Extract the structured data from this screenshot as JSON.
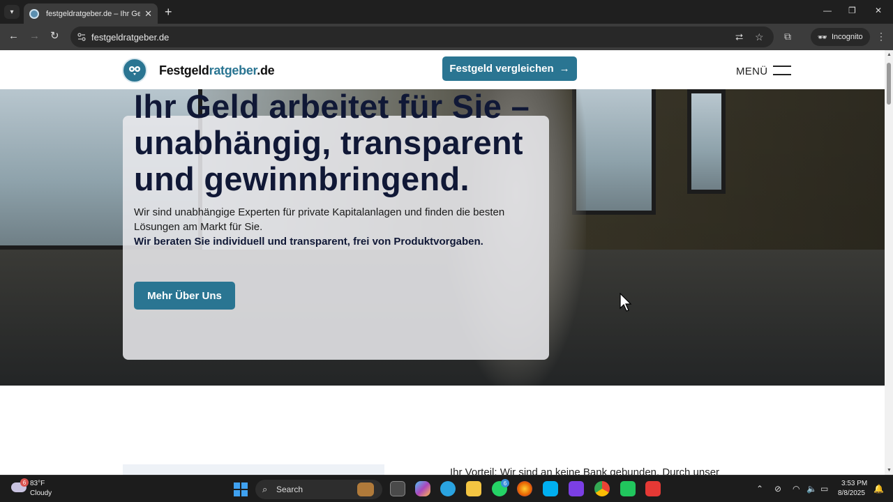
{
  "browser": {
    "tab_title": "festgeldratgeber.de – Ihr Geld a",
    "url": "festgeldratgeber.de",
    "incognito_label": "Incognito"
  },
  "site": {
    "logo_main": "Festgeld",
    "logo_accent": "ratgeber",
    "logo_tld": ".de",
    "cta_label": "Festgeld vergleichen",
    "menu_label": "MENÜ",
    "brand_color": "#2a7592"
  },
  "hero": {
    "title": "Ihr Geld arbeitet für Sie – unabhängig, transparent und gewinnbringend.",
    "subtitle": "Wir sind unabhängige Experten für private Kapitalanlagen und finden die besten Lösungen am Markt für Sie.",
    "subtitle_bold": "Wir beraten Sie individuell und transparent, frei von Produktvorgaben.",
    "button_label": "Mehr Über Uns"
  },
  "section": {
    "text": "Ihr Vorteil: Wir sind an keine Bank gebunden. Durch unser"
  },
  "taskbar": {
    "weather_temp": "83°F",
    "weather_desc": "Cloudy",
    "weather_badge": "6",
    "search_label": "Search",
    "whatsapp_badge": "6",
    "time": "3:53 PM",
    "date": "8/8/2025"
  }
}
